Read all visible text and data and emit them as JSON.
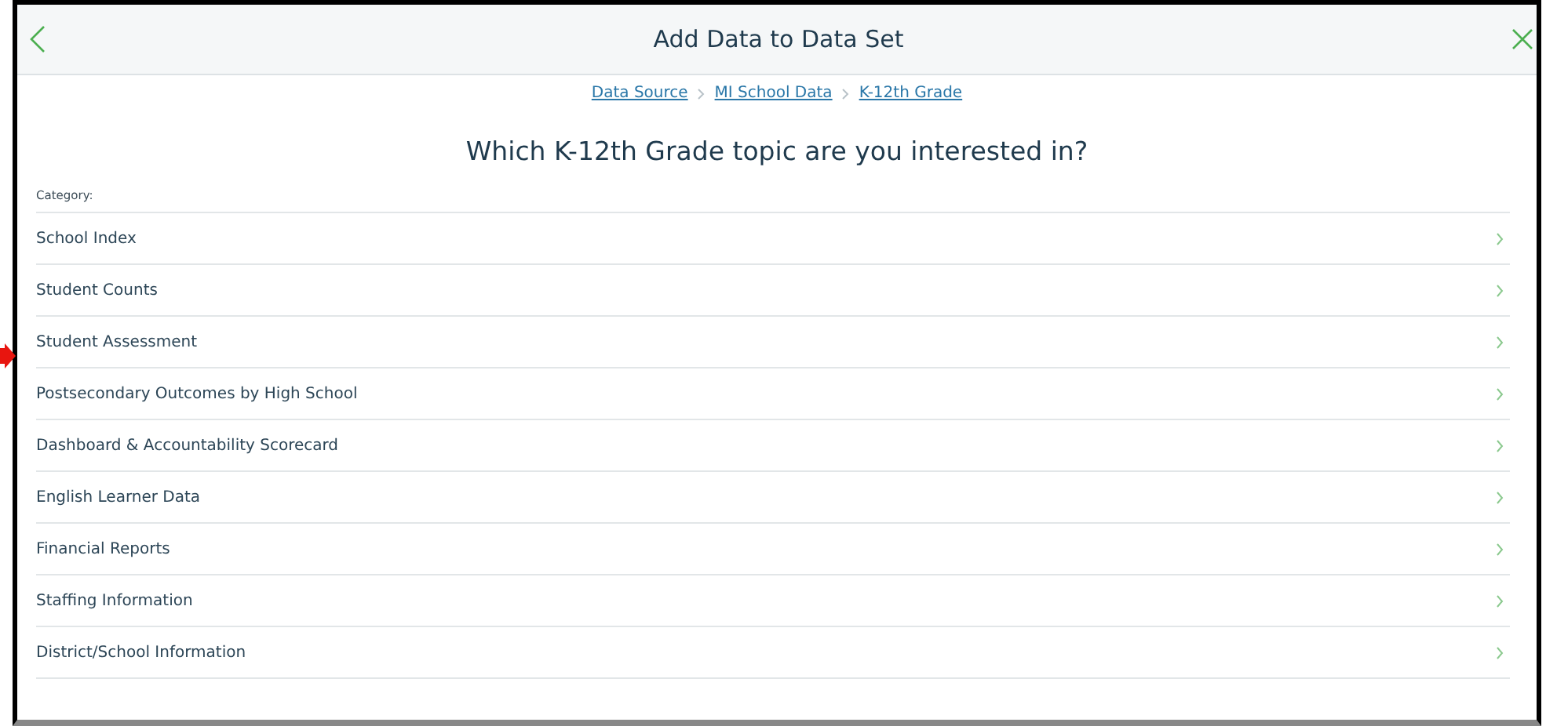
{
  "header": {
    "title": "Add Data to Data Set"
  },
  "breadcrumb": [
    "Data Source",
    "MI School Data",
    "K-12th Grade"
  ],
  "question": "Which K-12th Grade topic are you interested in?",
  "category_label": "Category:",
  "categories": [
    {
      "label": "School Index"
    },
    {
      "label": "Student Counts"
    },
    {
      "label": "Student Assessment"
    },
    {
      "label": "Postsecondary Outcomes by High School"
    },
    {
      "label": "Dashboard & Accountability Scorecard"
    },
    {
      "label": "English Learner Data"
    },
    {
      "label": "Financial Reports"
    },
    {
      "label": "Staffing Information"
    },
    {
      "label": "District/School Information"
    }
  ]
}
